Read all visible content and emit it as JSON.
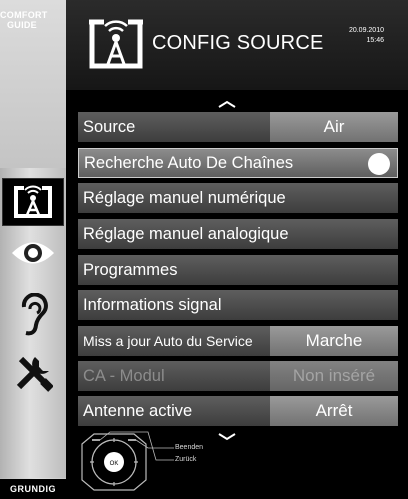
{
  "comfort_guide": {
    "line1": "COMFORT",
    "line2": "GUIDE"
  },
  "sidebar_icons": [
    "source-icon",
    "eye-icon",
    "ear-icon",
    "tools-icon"
  ],
  "brand": "GRUNDIG",
  "header": {
    "title": "CONFIG SOURCE",
    "date": "20.09.2010",
    "time": "15:46"
  },
  "menu": [
    {
      "label": "Source",
      "value": "Air"
    },
    {
      "label": "Recherche Auto De Chaînes",
      "toggle": true
    },
    {
      "label": "Réglage manuel numérique"
    },
    {
      "label": "Réglage manuel analogique"
    },
    {
      "label": "Programmes"
    },
    {
      "label": "Informations signal"
    },
    {
      "label": "Miss a jour Auto du Service",
      "value": "Marche"
    },
    {
      "label": "CA - Modul",
      "value": "Non inséré"
    },
    {
      "label": "Antenne active",
      "value": "Arrêt"
    }
  ],
  "nav_hints": {
    "ok_label": "OK",
    "exit": "Beenden",
    "back": "Zurück"
  },
  "colors": {
    "row": "#4a4a4a",
    "value_box": "#868686",
    "accent_white": "#ffffff"
  }
}
